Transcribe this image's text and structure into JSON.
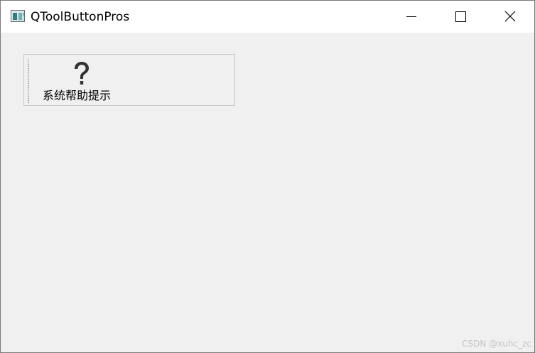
{
  "window": {
    "title": "QToolButtonPros",
    "icon": "qt-app-icon",
    "controls": {
      "minimize_icon": "minimize-icon",
      "maximize_icon": "maximize-icon",
      "close_icon": "close-icon"
    }
  },
  "toolbar": {
    "buttons": [
      {
        "icon": "help-question-icon",
        "label": "系统帮助提示"
      }
    ]
  },
  "watermark": {
    "text": "CSDN @xuhc_zc"
  },
  "colors": {
    "client_background": "#f0f0f0",
    "titlebar_background": "#ffffff",
    "icon_dark": "#333333"
  }
}
